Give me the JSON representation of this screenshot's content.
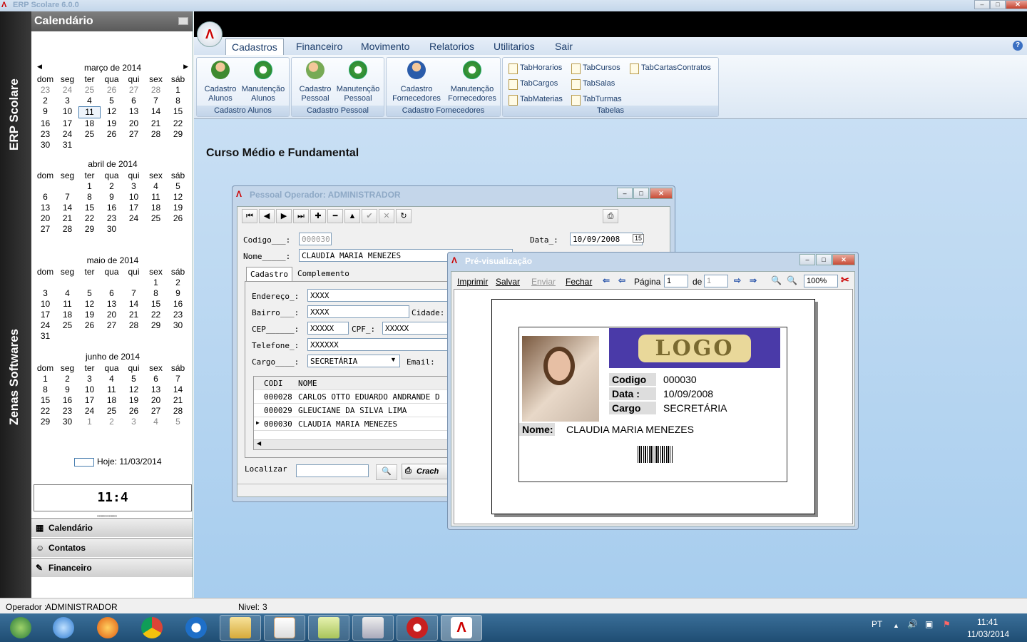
{
  "app": {
    "title": "ERP Scolare 6.0.0",
    "brand_vertical_top": "ERP Scolare",
    "brand_vertical_bottom": "Zenas Softwares"
  },
  "calendar": {
    "header": "Calendário",
    "weekdays": [
      "dom",
      "seg",
      "ter",
      "qua",
      "qui",
      "sex",
      "sáb"
    ],
    "months": [
      {
        "title": "março de 2014",
        "days": [
          "23",
          "24",
          "25",
          "26",
          "27",
          "28",
          "1",
          "2",
          "3",
          "4",
          "5",
          "6",
          "7",
          "8",
          "9",
          "10",
          "11",
          "12",
          "13",
          "14",
          "15",
          "16",
          "17",
          "18",
          "19",
          "20",
          "21",
          "22",
          "23",
          "24",
          "25",
          "26",
          "27",
          "28",
          "29",
          "30",
          "31",
          "",
          "",
          "",
          "",
          ""
        ]
      },
      {
        "title": "abril de 2014",
        "days": [
          "",
          "",
          "1",
          "2",
          "3",
          "4",
          "5",
          "6",
          "7",
          "8",
          "9",
          "10",
          "11",
          "12",
          "13",
          "14",
          "15",
          "16",
          "17",
          "18",
          "19",
          "20",
          "21",
          "22",
          "23",
          "24",
          "25",
          "26",
          "27",
          "28",
          "29",
          "30",
          "",
          "",
          ""
        ]
      },
      {
        "title": "maio de 2014",
        "days": [
          "",
          "",
          "",
          "",
          "",
          "1",
          "2",
          "3",
          "4",
          "5",
          "6",
          "7",
          "8",
          "9",
          "10",
          "11",
          "12",
          "13",
          "14",
          "15",
          "16",
          "17",
          "18",
          "19",
          "20",
          "21",
          "22",
          "23",
          "24",
          "25",
          "26",
          "27",
          "28",
          "29",
          "30",
          "31"
        ]
      },
      {
        "title": "junho de 2014",
        "days": [
          "",
          "",
          "",
          "",
          "",
          "",
          "",
          "1",
          "2",
          "3",
          "4",
          "5",
          "6",
          "7",
          "8",
          "9",
          "10",
          "11",
          "12",
          "13",
          "14",
          "15",
          "16",
          "17",
          "18",
          "19",
          "20",
          "21",
          "22",
          "23",
          "24",
          "25",
          "26",
          "27",
          "28",
          "29",
          "30",
          "1",
          "2",
          "3",
          "4",
          "5"
        ]
      }
    ],
    "today_label": "Hoje: 11/03/2014",
    "clock": "11:4"
  },
  "left_nav": [
    {
      "label": "Calendário",
      "icon": "calendar-icon"
    },
    {
      "label": "Contatos",
      "icon": "contacts-icon"
    },
    {
      "label": "Financeiro",
      "icon": "finance-icon"
    }
  ],
  "menu": [
    "Cadastros",
    "Financeiro",
    "Movimento",
    "Relatorios",
    "Utilitarios",
    "Sair"
  ],
  "ribbon": {
    "groups": [
      {
        "label": "Cadastro Alunos",
        "buttons": [
          "Cadastro\nAlunos",
          "Manutenção\nAlunos"
        ]
      },
      {
        "label": "Cadastro Pessoal",
        "buttons": [
          "Cadastro\nPessoal",
          "Manutenção\nPessoal"
        ]
      },
      {
        "label": "Cadastro Fornecedores",
        "buttons": [
          "Cadastro\nFornecedores",
          "Manutenção\nFornecedores"
        ]
      },
      {
        "label": "Tabelas",
        "buttons": [
          "TabHorarios",
          "TabCursos",
          "TabCartasContratos",
          "TabCargos",
          "TabSalas",
          "TabMaterias",
          "TabTurmas"
        ]
      }
    ]
  },
  "main_title": "Curso Médio e Fundamental",
  "pessoal": {
    "title": "Pessoal Operador: ADMINISTRADOR",
    "codigo_label": "Codigo___:",
    "codigo": "000030",
    "data_label": "Data_:",
    "data": "10/09/2008",
    "nome_label": "Nome_____:",
    "nome": "CLAUDIA MARIA MENEZES",
    "tabs": [
      "Cadastro",
      "Complemento"
    ],
    "endereco_label": "Endereço_:",
    "endereco": "XXXX",
    "bairro_label": "Bairro___:",
    "bairro": "XXXX",
    "cidade_label": "Cidade:",
    "cep_label": "CEP______:",
    "cep": "XXXXX",
    "cpf_label": "CPF_:",
    "cpf": "XXXXX",
    "telefone_label": "Telefone_:",
    "telefone": "XXXXXX",
    "cargo_label": "Cargo____:",
    "cargo": "SECRETÁRIA",
    "email_label": "Email:",
    "grid_headers": [
      "CODI",
      "NOME"
    ],
    "rows": [
      {
        "codi": "000028",
        "nome": "CARLOS OTTO EDUARDO ANDRANDE D"
      },
      {
        "codi": "000029",
        "nome": "GLEUCIANE DA SILVA LIMA"
      },
      {
        "codi": "000030",
        "nome": "CLAUDIA MARIA MENEZES"
      }
    ],
    "localizar_label": "Localizar",
    "cracha_label": "Crach"
  },
  "preview": {
    "title": "Pré-visualização",
    "toolbar": [
      "Imprimir",
      "Salvar",
      "Enviar",
      "Fechar"
    ],
    "pagina_label": "Página",
    "page": "1",
    "de_label": "de",
    "pages": "1",
    "zoom": "100%",
    "card": {
      "logo": "LOGO",
      "codigo_label": "Codigo",
      "codigo": "000030",
      "data_label": "Data :",
      "data": "10/09/2008",
      "cargo_label": "Cargo",
      "cargo": "SECRETÁRIA",
      "nome_label": "Nome:",
      "nome": "CLAUDIA MARIA MENEZES"
    }
  },
  "status": {
    "operador_label": "Operador :",
    "operador": "ADMINISTRADOR",
    "nivel_label": "Nivel:",
    "nivel": "3"
  },
  "taskbar": {
    "lang": "PT",
    "time": "11:41",
    "date": "11/03/2014"
  },
  "colors": {
    "accent": "#1c3d6b",
    "desktop_top": "#d0e3f5",
    "desktop_bottom": "#a7cdee",
    "logo_bg": "#4a3aa8"
  }
}
